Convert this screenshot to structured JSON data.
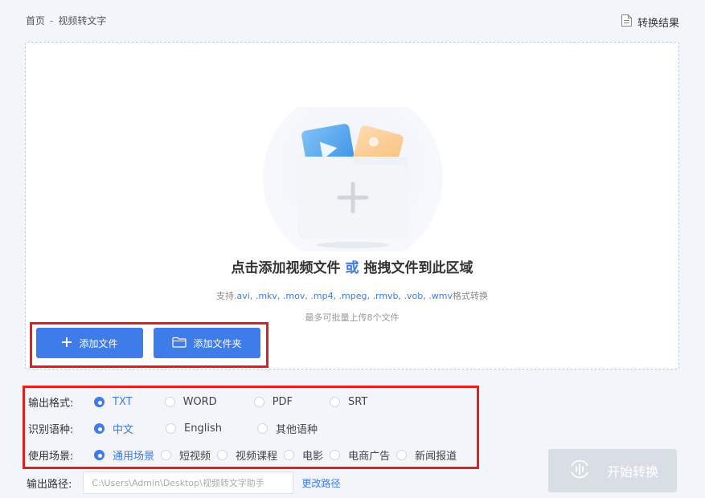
{
  "breadcrumb": {
    "home": "首页",
    "separator": "-",
    "current": "视频转文字"
  },
  "header": {
    "result_label": "转换结果"
  },
  "dropzone": {
    "title_left": "点击添加视频文件",
    "title_or": "或",
    "title_right": "拖拽文件到此区域",
    "formats_prefix": "支持",
    "formats_list": ".avi, .mkv, .mov, .mp4, .mpeg, .rmvb, .vob, .wmv",
    "formats_suffix": "格式转换",
    "limit": "最多可批量上传8个文件"
  },
  "buttons": {
    "add_file": "添加文件",
    "add_folder": "添加文件夹",
    "start": "开始转换"
  },
  "options": {
    "output_format": {
      "label": "输出格式:",
      "items": [
        "TXT",
        "WORD",
        "PDF",
        "SRT"
      ],
      "selected": "TXT"
    },
    "language": {
      "label": "识别语种:",
      "items": [
        "中文",
        "English",
        "其他语种"
      ],
      "selected": "中文"
    },
    "scene": {
      "label": "使用场景:",
      "items": [
        "通用场景",
        "短视频",
        "视频课程",
        "电影",
        "电商广告",
        "新闻报道"
      ],
      "selected": "通用场景"
    }
  },
  "output_path": {
    "label": "输出路径:",
    "value": "C:\\Users\\Admin\\Desktop\\视频转文字助手",
    "change_label": "更改路径"
  },
  "colors": {
    "accent": "#3d7ce9",
    "highlight_border": "#e01f1f",
    "disabled": "#d9dde4"
  }
}
